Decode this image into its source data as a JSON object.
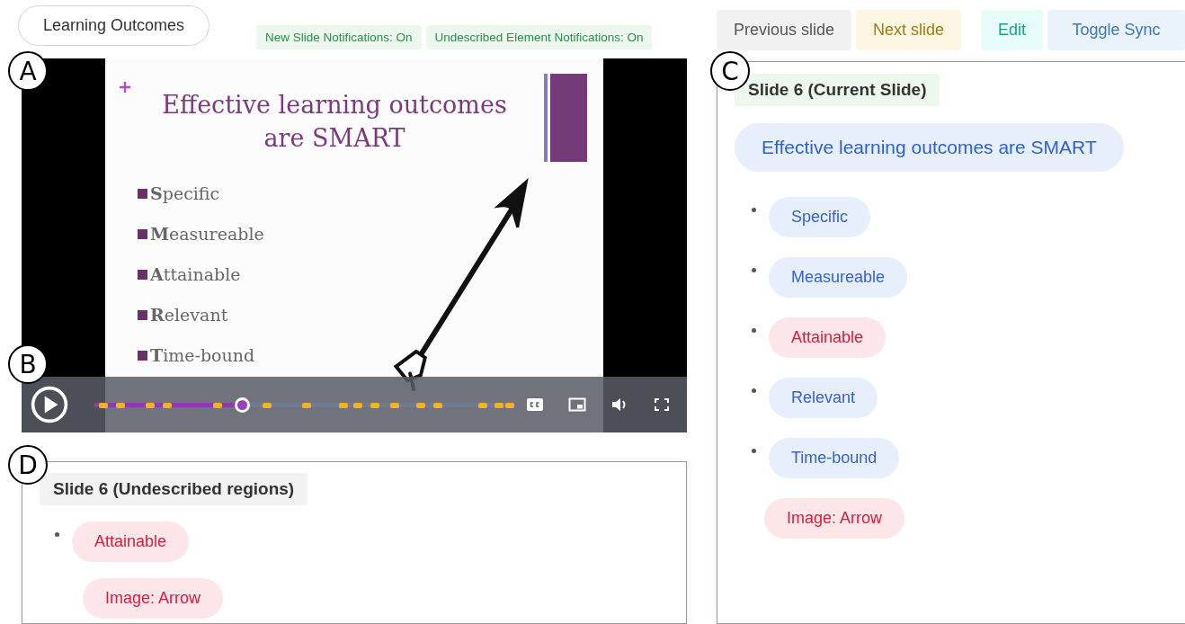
{
  "outcomes_button": "Learning Outcomes",
  "notifications": [
    {
      "label": "New Slide Notifications: On"
    },
    {
      "label": "Undescribed Element Notifications: On"
    }
  ],
  "player": {
    "callout": "A",
    "controls_callout": "B",
    "slide": {
      "title": "Effective learning outcomes are SMART",
      "bullets": [
        "**S**pecific",
        "**M**easureable",
        "**A**ttainable",
        "**R**elevant",
        "**T**ime-bound"
      ]
    },
    "progress": {
      "level": 0.35
    }
  },
  "undescribed_panel": {
    "callout": "D",
    "heading": "Slide 6 (Undescribed regions)",
    "items": [
      {
        "kind": "text",
        "label": "Attainable",
        "described": false
      },
      {
        "kind": "image",
        "label": "Image: Arrow",
        "described": false
      }
    ]
  },
  "nav_buttons": [
    {
      "kind": "previous",
      "label": "Previous slide"
    },
    {
      "kind": "next",
      "label": "Next slide"
    },
    {
      "kind": "edit",
      "label": "Edit"
    },
    {
      "kind": "sync",
      "label": "Toggle Sync"
    }
  ],
  "current_panel": {
    "callout": "C",
    "heading": "Slide 6 (Current Slide)",
    "title": "Effective learning outcomes are SMART",
    "items": [
      {
        "kind": "text",
        "label": "Specific",
        "described": true
      },
      {
        "kind": "text",
        "label": "Measureable",
        "described": true
      },
      {
        "kind": "text",
        "label": "Attainable",
        "described": false
      },
      {
        "kind": "text",
        "label": "Relevant",
        "described": true
      },
      {
        "kind": "text",
        "label": "Time-bound",
        "described": true
      },
      {
        "kind": "image",
        "label": "Image: Arrow",
        "described": false
      }
    ]
  }
}
